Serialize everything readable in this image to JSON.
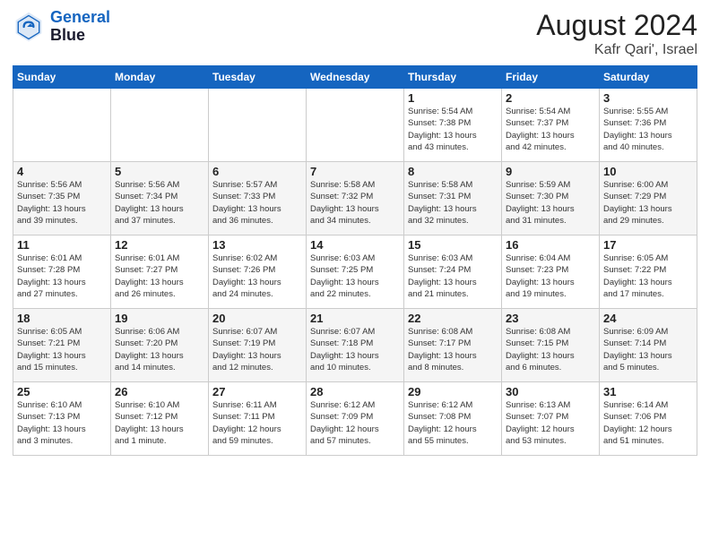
{
  "header": {
    "logo_line1": "General",
    "logo_line2": "Blue",
    "month": "August 2024",
    "location": "Kafr Qari', Israel"
  },
  "days_of_week": [
    "Sunday",
    "Monday",
    "Tuesday",
    "Wednesday",
    "Thursday",
    "Friday",
    "Saturday"
  ],
  "weeks": [
    [
      {
        "day": "",
        "info": ""
      },
      {
        "day": "",
        "info": ""
      },
      {
        "day": "",
        "info": ""
      },
      {
        "day": "",
        "info": ""
      },
      {
        "day": "1",
        "info": "Sunrise: 5:54 AM\nSunset: 7:38 PM\nDaylight: 13 hours\nand 43 minutes."
      },
      {
        "day": "2",
        "info": "Sunrise: 5:54 AM\nSunset: 7:37 PM\nDaylight: 13 hours\nand 42 minutes."
      },
      {
        "day": "3",
        "info": "Sunrise: 5:55 AM\nSunset: 7:36 PM\nDaylight: 13 hours\nand 40 minutes."
      }
    ],
    [
      {
        "day": "4",
        "info": "Sunrise: 5:56 AM\nSunset: 7:35 PM\nDaylight: 13 hours\nand 39 minutes."
      },
      {
        "day": "5",
        "info": "Sunrise: 5:56 AM\nSunset: 7:34 PM\nDaylight: 13 hours\nand 37 minutes."
      },
      {
        "day": "6",
        "info": "Sunrise: 5:57 AM\nSunset: 7:33 PM\nDaylight: 13 hours\nand 36 minutes."
      },
      {
        "day": "7",
        "info": "Sunrise: 5:58 AM\nSunset: 7:32 PM\nDaylight: 13 hours\nand 34 minutes."
      },
      {
        "day": "8",
        "info": "Sunrise: 5:58 AM\nSunset: 7:31 PM\nDaylight: 13 hours\nand 32 minutes."
      },
      {
        "day": "9",
        "info": "Sunrise: 5:59 AM\nSunset: 7:30 PM\nDaylight: 13 hours\nand 31 minutes."
      },
      {
        "day": "10",
        "info": "Sunrise: 6:00 AM\nSunset: 7:29 PM\nDaylight: 13 hours\nand 29 minutes."
      }
    ],
    [
      {
        "day": "11",
        "info": "Sunrise: 6:01 AM\nSunset: 7:28 PM\nDaylight: 13 hours\nand 27 minutes."
      },
      {
        "day": "12",
        "info": "Sunrise: 6:01 AM\nSunset: 7:27 PM\nDaylight: 13 hours\nand 26 minutes."
      },
      {
        "day": "13",
        "info": "Sunrise: 6:02 AM\nSunset: 7:26 PM\nDaylight: 13 hours\nand 24 minutes."
      },
      {
        "day": "14",
        "info": "Sunrise: 6:03 AM\nSunset: 7:25 PM\nDaylight: 13 hours\nand 22 minutes."
      },
      {
        "day": "15",
        "info": "Sunrise: 6:03 AM\nSunset: 7:24 PM\nDaylight: 13 hours\nand 21 minutes."
      },
      {
        "day": "16",
        "info": "Sunrise: 6:04 AM\nSunset: 7:23 PM\nDaylight: 13 hours\nand 19 minutes."
      },
      {
        "day": "17",
        "info": "Sunrise: 6:05 AM\nSunset: 7:22 PM\nDaylight: 13 hours\nand 17 minutes."
      }
    ],
    [
      {
        "day": "18",
        "info": "Sunrise: 6:05 AM\nSunset: 7:21 PM\nDaylight: 13 hours\nand 15 minutes."
      },
      {
        "day": "19",
        "info": "Sunrise: 6:06 AM\nSunset: 7:20 PM\nDaylight: 13 hours\nand 14 minutes."
      },
      {
        "day": "20",
        "info": "Sunrise: 6:07 AM\nSunset: 7:19 PM\nDaylight: 13 hours\nand 12 minutes."
      },
      {
        "day": "21",
        "info": "Sunrise: 6:07 AM\nSunset: 7:18 PM\nDaylight: 13 hours\nand 10 minutes."
      },
      {
        "day": "22",
        "info": "Sunrise: 6:08 AM\nSunset: 7:17 PM\nDaylight: 13 hours\nand 8 minutes."
      },
      {
        "day": "23",
        "info": "Sunrise: 6:08 AM\nSunset: 7:15 PM\nDaylight: 13 hours\nand 6 minutes."
      },
      {
        "day": "24",
        "info": "Sunrise: 6:09 AM\nSunset: 7:14 PM\nDaylight: 13 hours\nand 5 minutes."
      }
    ],
    [
      {
        "day": "25",
        "info": "Sunrise: 6:10 AM\nSunset: 7:13 PM\nDaylight: 13 hours\nand 3 minutes."
      },
      {
        "day": "26",
        "info": "Sunrise: 6:10 AM\nSunset: 7:12 PM\nDaylight: 13 hours\nand 1 minute."
      },
      {
        "day": "27",
        "info": "Sunrise: 6:11 AM\nSunset: 7:11 PM\nDaylight: 12 hours\nand 59 minutes."
      },
      {
        "day": "28",
        "info": "Sunrise: 6:12 AM\nSunset: 7:09 PM\nDaylight: 12 hours\nand 57 minutes."
      },
      {
        "day": "29",
        "info": "Sunrise: 6:12 AM\nSunset: 7:08 PM\nDaylight: 12 hours\nand 55 minutes."
      },
      {
        "day": "30",
        "info": "Sunrise: 6:13 AM\nSunset: 7:07 PM\nDaylight: 12 hours\nand 53 minutes."
      },
      {
        "day": "31",
        "info": "Sunrise: 6:14 AM\nSunset: 7:06 PM\nDaylight: 12 hours\nand 51 minutes."
      }
    ]
  ]
}
